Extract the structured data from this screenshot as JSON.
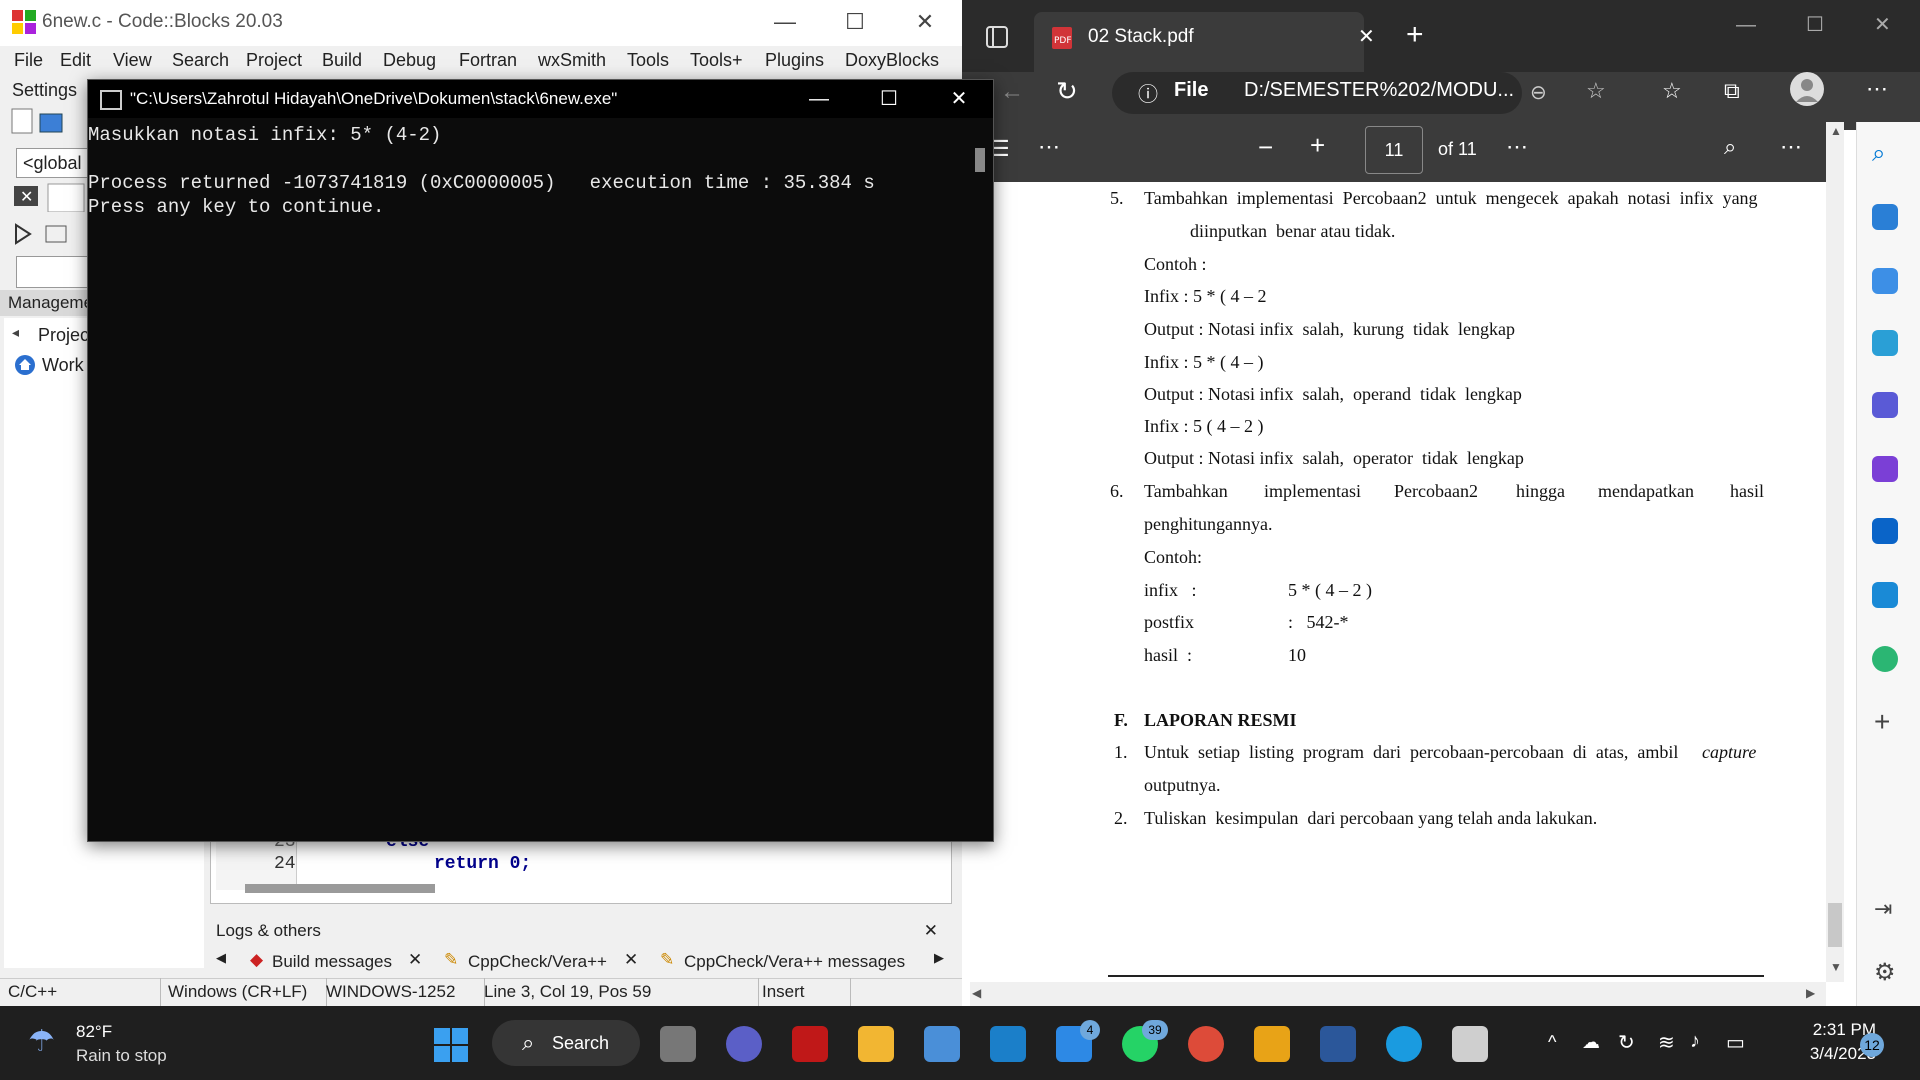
{
  "codeblocks": {
    "title": "6new.c - Code::Blocks 20.03",
    "menu": [
      "File",
      "Edit",
      "View",
      "Search",
      "Project",
      "Build",
      "Debug",
      "Fortran",
      "wxSmith",
      "Tools",
      "Tools+",
      "Plugins",
      "DoxyBlocks"
    ],
    "settings": "Settings",
    "global_select": "<global",
    "management": "Manageme",
    "tree": {
      "projects": "Projec",
      "workspace": "Work"
    },
    "code_lines": [
      {
        "num": "23",
        "text": "else"
      },
      {
        "num": "24",
        "text": "return 0;"
      }
    ],
    "logs_title": "Logs & others",
    "log_tabs": [
      "Build messages",
      "CppCheck/Vera++",
      "CppCheck/Vera++ messages"
    ],
    "status": [
      "C/C++",
      "Windows (CR+LF)",
      "WINDOWS-1252",
      "Line 3, Col 19, Pos 59",
      "Insert"
    ]
  },
  "console": {
    "title": "\"C:\\Users\\Zahrotul Hidayah\\OneDrive\\Dokumen\\stack\\6new.exe\"",
    "lines": [
      "Masukkan notasi infix: 5* (4-2)",
      "",
      "Process returned -1073741819 (0xC0000005)   execution time : 35.384 s",
      "Press any key to continue."
    ]
  },
  "edge": {
    "tab_title": "02 Stack.pdf",
    "url_scheme": "File",
    "url": "D:/SEMESTER%202/MODU...",
    "page_current": "11",
    "page_total": "of 11"
  },
  "pdf": {
    "item5_num": "5.",
    "item5_line1": "Tambahkan  implementasi  Percobaan2  untuk  mengecek  apakah  notasi  infix  yang",
    "item5_line2": "diinputkan  benar atau tidak.",
    "contoh1": "Contoh :",
    "ex1_infix": "Infix : 5 * ( 4 – 2",
    "ex1_output": "Output : Notasi infix  salah,  kurung  tidak  lengkap",
    "ex2_infix": "Infix : 5 * ( 4 – )",
    "ex2_output": "Output : Notasi infix  salah,  operand  tidak  lengkap",
    "ex3_infix": "Infix : 5 ( 4 – 2 )",
    "ex3_output": "Output : Notasi infix  salah,  operator  tidak  lengkap",
    "item6_num": "6.",
    "item6_words": [
      "Tambahkan",
      "implementasi",
      "Percobaan2",
      "hingga",
      "mendapatkan",
      "hasil"
    ],
    "item6_line2": "penghitungannya.",
    "contoh2": "Contoh:",
    "calc": [
      {
        "label": "infix   :",
        "value": "5 * ( 4 – 2 )"
      },
      {
        "label": "postfix",
        "value": ":   542-*"
      },
      {
        "label": "hasil  :",
        "value": "10"
      }
    ],
    "section_letter": "F.",
    "section_title": "LAPORAN RESMI",
    "laporan1_num": "1.",
    "laporan1_line1": "Untuk  setiap  listing  program  dari  percobaan-percobaan  di  atas,  ambil",
    "laporan1_capture": "capture",
    "laporan1_line2": "outputnya.",
    "laporan2_num": "2.",
    "laporan2_line1": "Tuliskan  kesimpulan  dari percobaan yang telah anda lakukan."
  },
  "taskbar": {
    "temperature": "82°F",
    "weather": "Rain to stop",
    "search": "Search",
    "mail_badge": "4",
    "whatsapp_badge": "39",
    "time": "2:31 PM",
    "date": "3/4/2023",
    "notifications": "12"
  },
  "colors": {
    "console_bg": "#0c0c0c",
    "edge_dark": "#3b3b3b",
    "taskbar": "#1f1f1f",
    "accent": "#0078d4"
  }
}
